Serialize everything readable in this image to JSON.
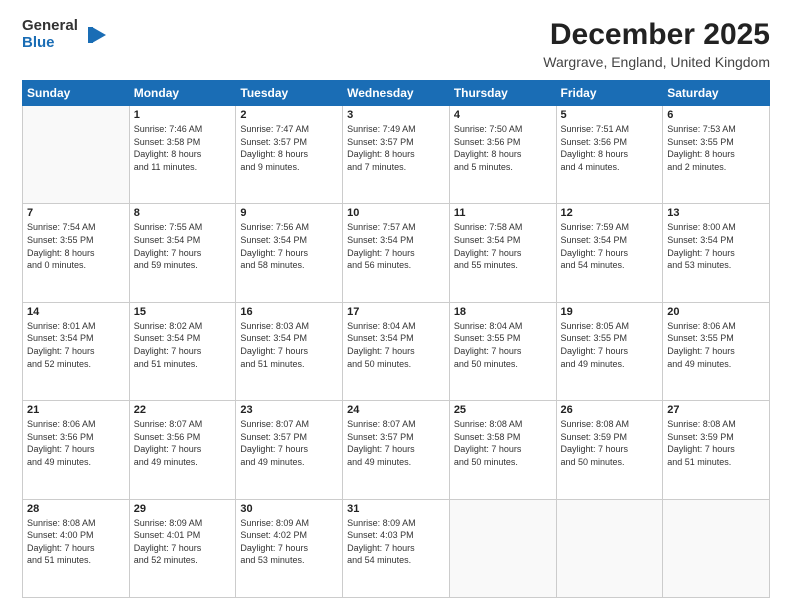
{
  "logo": {
    "general": "General",
    "blue": "Blue"
  },
  "header": {
    "title": "December 2025",
    "subtitle": "Wargrave, England, United Kingdom"
  },
  "weekdays": [
    "Sunday",
    "Monday",
    "Tuesday",
    "Wednesday",
    "Thursday",
    "Friday",
    "Saturday"
  ],
  "weeks": [
    [
      {
        "day": "",
        "info": ""
      },
      {
        "day": "1",
        "info": "Sunrise: 7:46 AM\nSunset: 3:58 PM\nDaylight: 8 hours\nand 11 minutes."
      },
      {
        "day": "2",
        "info": "Sunrise: 7:47 AM\nSunset: 3:57 PM\nDaylight: 8 hours\nand 9 minutes."
      },
      {
        "day": "3",
        "info": "Sunrise: 7:49 AM\nSunset: 3:57 PM\nDaylight: 8 hours\nand 7 minutes."
      },
      {
        "day": "4",
        "info": "Sunrise: 7:50 AM\nSunset: 3:56 PM\nDaylight: 8 hours\nand 5 minutes."
      },
      {
        "day": "5",
        "info": "Sunrise: 7:51 AM\nSunset: 3:56 PM\nDaylight: 8 hours\nand 4 minutes."
      },
      {
        "day": "6",
        "info": "Sunrise: 7:53 AM\nSunset: 3:55 PM\nDaylight: 8 hours\nand 2 minutes."
      }
    ],
    [
      {
        "day": "7",
        "info": "Sunrise: 7:54 AM\nSunset: 3:55 PM\nDaylight: 8 hours\nand 0 minutes."
      },
      {
        "day": "8",
        "info": "Sunrise: 7:55 AM\nSunset: 3:54 PM\nDaylight: 7 hours\nand 59 minutes."
      },
      {
        "day": "9",
        "info": "Sunrise: 7:56 AM\nSunset: 3:54 PM\nDaylight: 7 hours\nand 58 minutes."
      },
      {
        "day": "10",
        "info": "Sunrise: 7:57 AM\nSunset: 3:54 PM\nDaylight: 7 hours\nand 56 minutes."
      },
      {
        "day": "11",
        "info": "Sunrise: 7:58 AM\nSunset: 3:54 PM\nDaylight: 7 hours\nand 55 minutes."
      },
      {
        "day": "12",
        "info": "Sunrise: 7:59 AM\nSunset: 3:54 PM\nDaylight: 7 hours\nand 54 minutes."
      },
      {
        "day": "13",
        "info": "Sunrise: 8:00 AM\nSunset: 3:54 PM\nDaylight: 7 hours\nand 53 minutes."
      }
    ],
    [
      {
        "day": "14",
        "info": "Sunrise: 8:01 AM\nSunset: 3:54 PM\nDaylight: 7 hours\nand 52 minutes."
      },
      {
        "day": "15",
        "info": "Sunrise: 8:02 AM\nSunset: 3:54 PM\nDaylight: 7 hours\nand 51 minutes."
      },
      {
        "day": "16",
        "info": "Sunrise: 8:03 AM\nSunset: 3:54 PM\nDaylight: 7 hours\nand 51 minutes."
      },
      {
        "day": "17",
        "info": "Sunrise: 8:04 AM\nSunset: 3:54 PM\nDaylight: 7 hours\nand 50 minutes."
      },
      {
        "day": "18",
        "info": "Sunrise: 8:04 AM\nSunset: 3:55 PM\nDaylight: 7 hours\nand 50 minutes."
      },
      {
        "day": "19",
        "info": "Sunrise: 8:05 AM\nSunset: 3:55 PM\nDaylight: 7 hours\nand 49 minutes."
      },
      {
        "day": "20",
        "info": "Sunrise: 8:06 AM\nSunset: 3:55 PM\nDaylight: 7 hours\nand 49 minutes."
      }
    ],
    [
      {
        "day": "21",
        "info": "Sunrise: 8:06 AM\nSunset: 3:56 PM\nDaylight: 7 hours\nand 49 minutes."
      },
      {
        "day": "22",
        "info": "Sunrise: 8:07 AM\nSunset: 3:56 PM\nDaylight: 7 hours\nand 49 minutes."
      },
      {
        "day": "23",
        "info": "Sunrise: 8:07 AM\nSunset: 3:57 PM\nDaylight: 7 hours\nand 49 minutes."
      },
      {
        "day": "24",
        "info": "Sunrise: 8:07 AM\nSunset: 3:57 PM\nDaylight: 7 hours\nand 49 minutes."
      },
      {
        "day": "25",
        "info": "Sunrise: 8:08 AM\nSunset: 3:58 PM\nDaylight: 7 hours\nand 50 minutes."
      },
      {
        "day": "26",
        "info": "Sunrise: 8:08 AM\nSunset: 3:59 PM\nDaylight: 7 hours\nand 50 minutes."
      },
      {
        "day": "27",
        "info": "Sunrise: 8:08 AM\nSunset: 3:59 PM\nDaylight: 7 hours\nand 51 minutes."
      }
    ],
    [
      {
        "day": "28",
        "info": "Sunrise: 8:08 AM\nSunset: 4:00 PM\nDaylight: 7 hours\nand 51 minutes."
      },
      {
        "day": "29",
        "info": "Sunrise: 8:09 AM\nSunset: 4:01 PM\nDaylight: 7 hours\nand 52 minutes."
      },
      {
        "day": "30",
        "info": "Sunrise: 8:09 AM\nSunset: 4:02 PM\nDaylight: 7 hours\nand 53 minutes."
      },
      {
        "day": "31",
        "info": "Sunrise: 8:09 AM\nSunset: 4:03 PM\nDaylight: 7 hours\nand 54 minutes."
      },
      {
        "day": "",
        "info": ""
      },
      {
        "day": "",
        "info": ""
      },
      {
        "day": "",
        "info": ""
      }
    ]
  ]
}
